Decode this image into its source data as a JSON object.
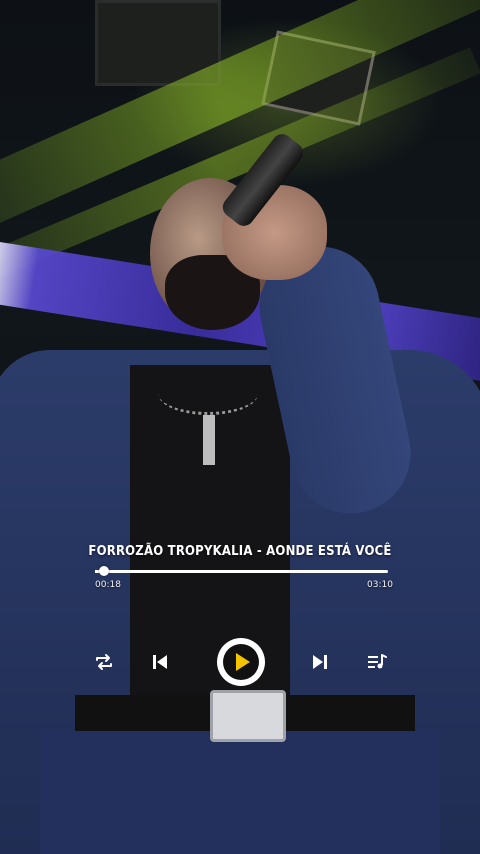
{
  "player": {
    "song_title": "FORROZÃO TROPYKALIA - AONDE ESTÁ VOCÊ",
    "current_time": "00:18",
    "total_time": "03:10",
    "progress_fraction": 0.03,
    "accent_color": "#ffffff",
    "play_icon_color": "#f5c400",
    "controls": [
      "repeat-icon",
      "previous-icon",
      "play-icon",
      "next-icon",
      "queue-icon"
    ]
  }
}
